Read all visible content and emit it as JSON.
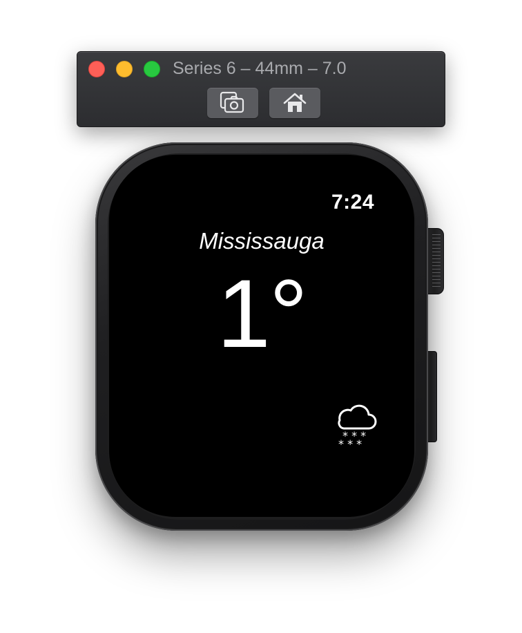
{
  "window": {
    "title": "Series 6 – 44mm – 7.0",
    "buttons": [
      {
        "name": "screenshot",
        "icon": "camera-icon"
      },
      {
        "name": "home",
        "icon": "home-icon"
      }
    ],
    "traffic_lights": {
      "close": "#fe5f57",
      "minimize": "#febc2e",
      "zoom": "#28c840"
    }
  },
  "watch": {
    "time": "7:24",
    "city": "Mississauga",
    "temperature": "1°",
    "condition_icon": "snow-cloud-icon"
  }
}
